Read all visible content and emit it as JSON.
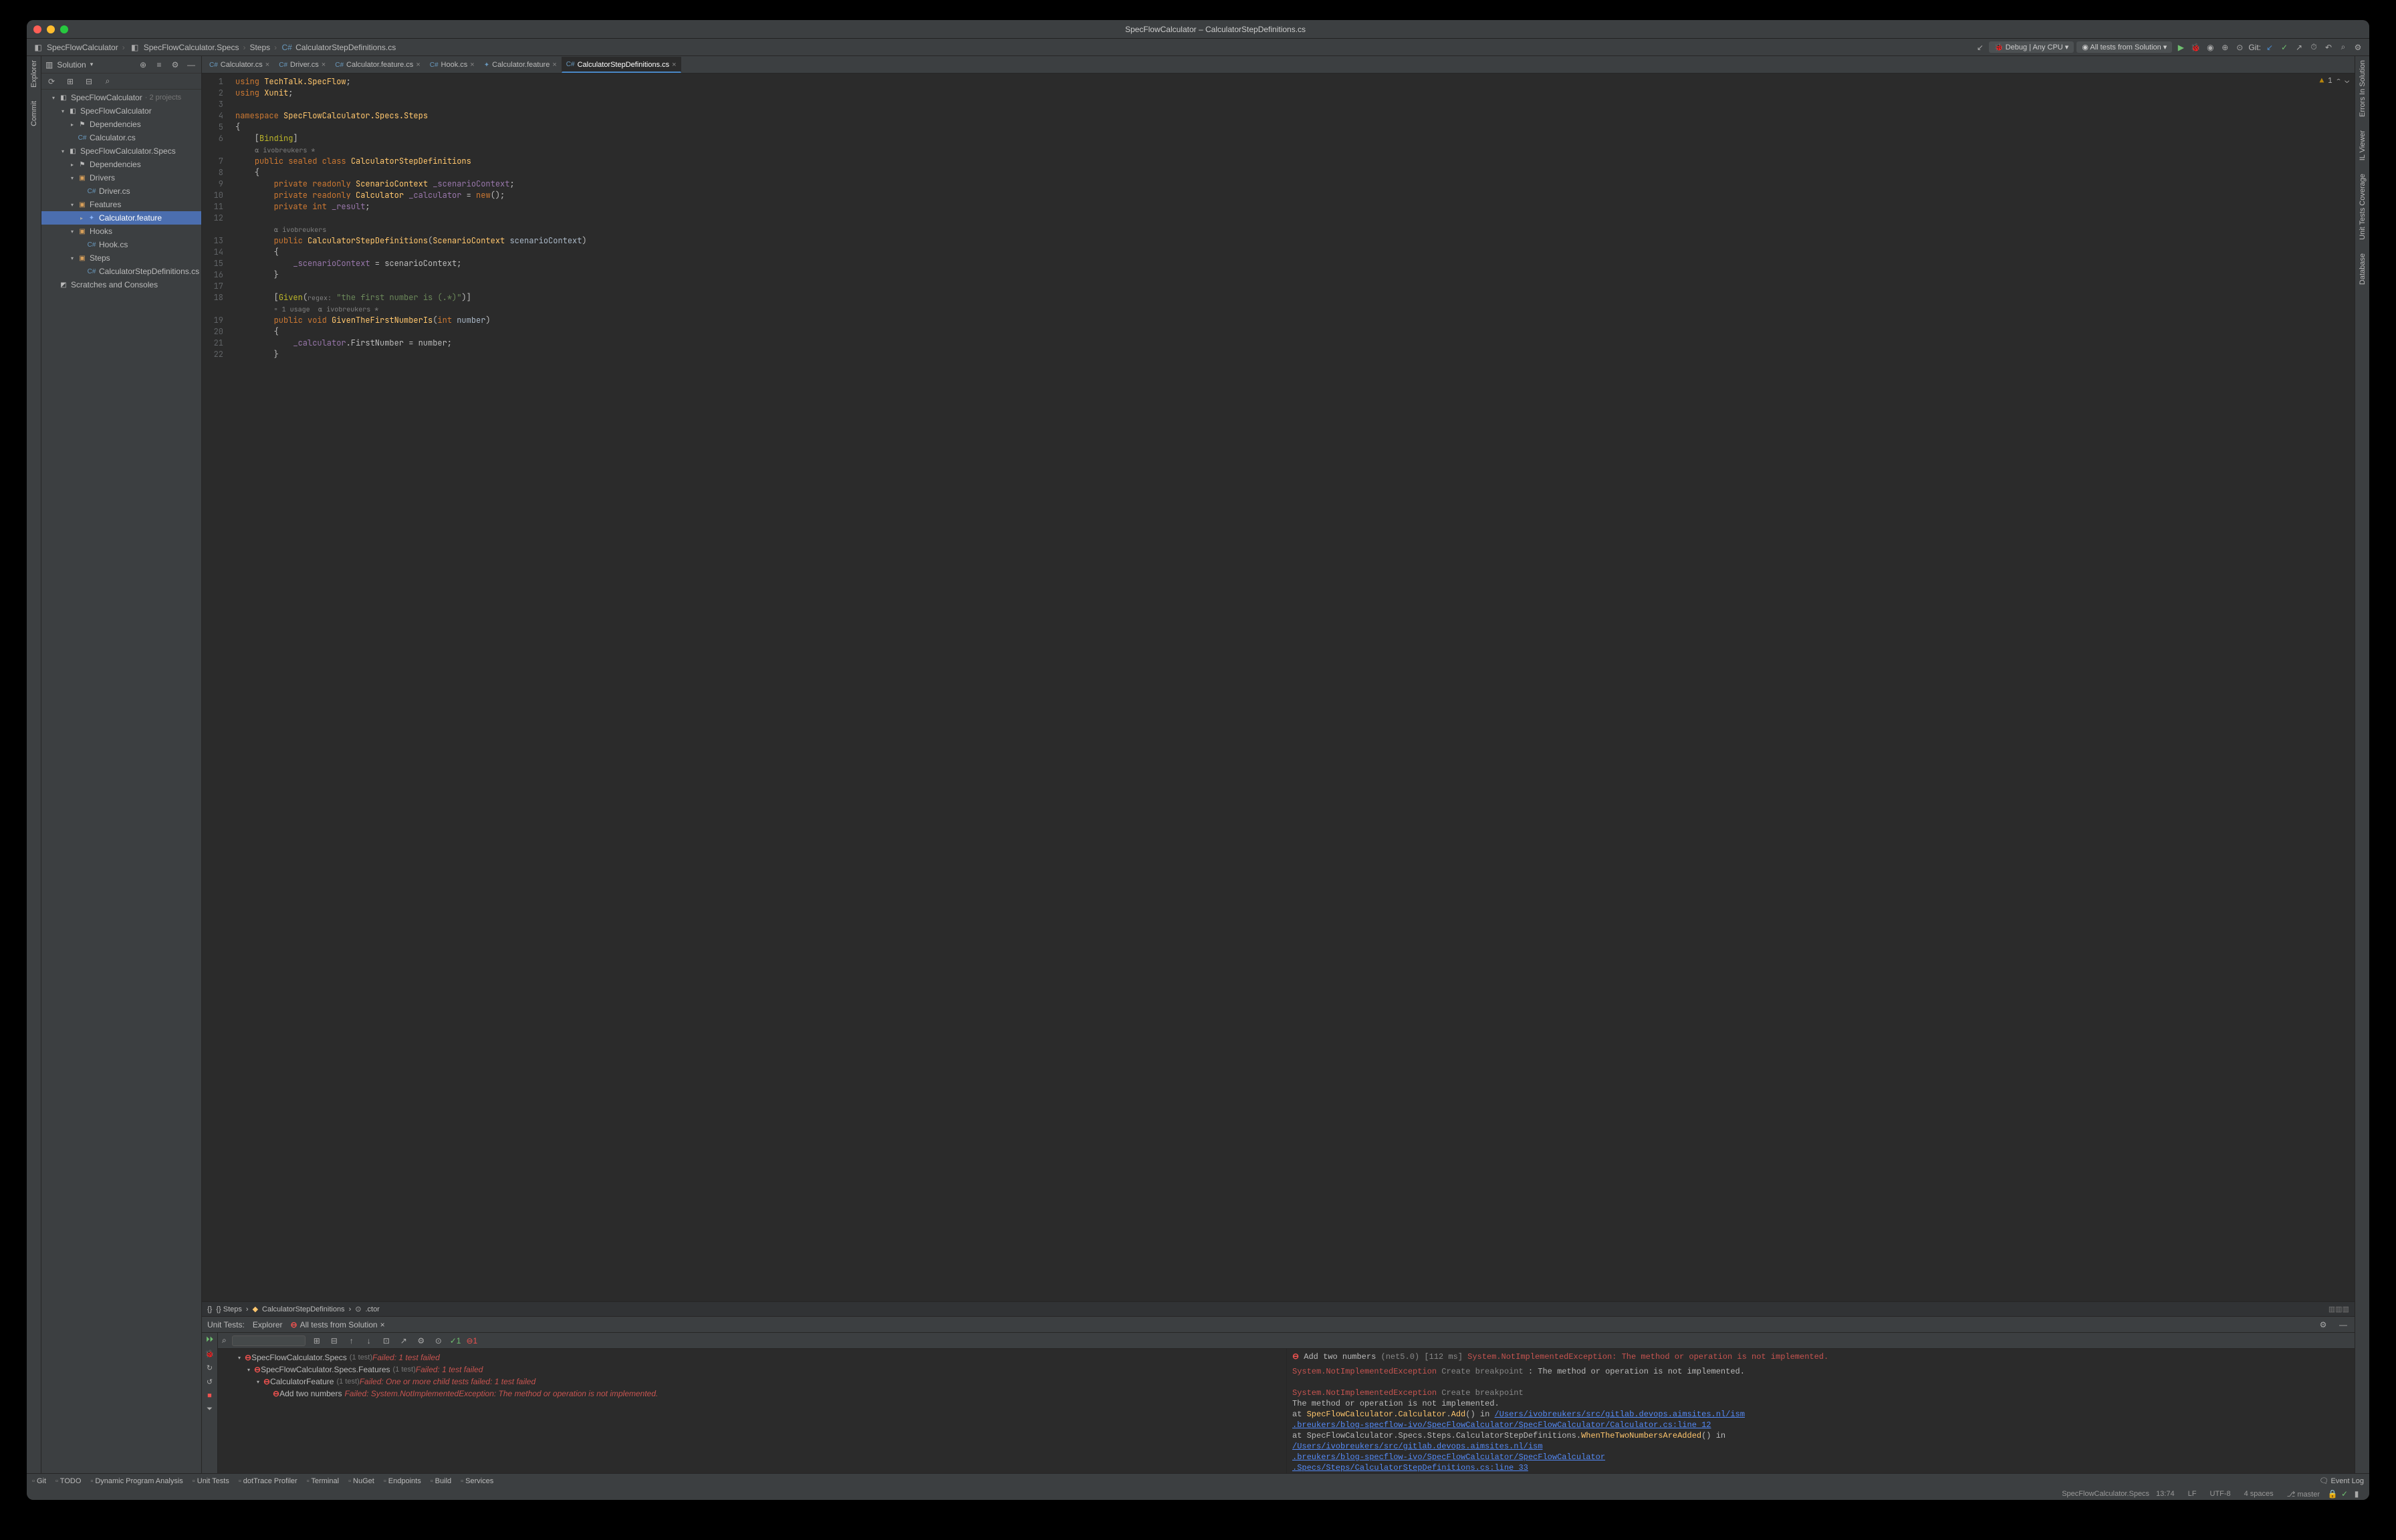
{
  "window_title": "SpecFlowCalculator – CalculatorStepDefinitions.cs",
  "breadcrumbs": [
    "SpecFlowCalculator",
    "SpecFlowCalculator.Specs",
    "Steps",
    "CalculatorStepDefinitions.cs"
  ],
  "run_config": "Debug | Any CPU",
  "run_target": "All tests from Solution",
  "vcs_label": "Git:",
  "left_gutter": [
    "Explorer",
    "Commit"
  ],
  "right_gutter": [
    "Errors In Solution",
    "IL Viewer",
    "Unit Tests Coverage",
    "Database"
  ],
  "explorer": {
    "title": "Solution",
    "tree": [
      {
        "pad": 16,
        "arrow": "▾",
        "icon": "◧",
        "ic": "",
        "label": "SpecFlowCalculator",
        "sub": " · 2 projects"
      },
      {
        "pad": 30,
        "arrow": "▾",
        "icon": "◧",
        "ic": "",
        "label": "SpecFlowCalculator"
      },
      {
        "pad": 44,
        "arrow": "▸",
        "icon": "⚑",
        "ic": "",
        "label": "Dependencies"
      },
      {
        "pad": 44,
        "arrow": "",
        "icon": "C#",
        "ic": "fi-cs",
        "label": "Calculator.cs"
      },
      {
        "pad": 30,
        "arrow": "▾",
        "icon": "◧",
        "ic": "",
        "label": "SpecFlowCalculator.Specs"
      },
      {
        "pad": 44,
        "arrow": "▸",
        "icon": "⚑",
        "ic": "",
        "label": "Dependencies"
      },
      {
        "pad": 44,
        "arrow": "▾",
        "icon": "▣",
        "ic": "fi-folder",
        "label": "Drivers"
      },
      {
        "pad": 58,
        "arrow": "",
        "icon": "C#",
        "ic": "fi-cs",
        "label": "Driver.cs"
      },
      {
        "pad": 44,
        "arrow": "▾",
        "icon": "▣",
        "ic": "fi-folder",
        "label": "Features"
      },
      {
        "pad": 58,
        "arrow": "▸",
        "icon": "✦",
        "ic": "fi-feature",
        "label": "Calculator.feature",
        "sel": true
      },
      {
        "pad": 44,
        "arrow": "▾",
        "icon": "▣",
        "ic": "fi-folder",
        "label": "Hooks"
      },
      {
        "pad": 58,
        "arrow": "",
        "icon": "C#",
        "ic": "fi-cs",
        "label": "Hook.cs"
      },
      {
        "pad": 44,
        "arrow": "▾",
        "icon": "▣",
        "ic": "fi-folder",
        "label": "Steps"
      },
      {
        "pad": 58,
        "arrow": "",
        "icon": "C#",
        "ic": "fi-cs",
        "label": "CalculatorStepDefinitions.cs"
      },
      {
        "pad": 16,
        "arrow": "",
        "icon": "◩",
        "ic": "",
        "label": "Scratches and Consoles"
      }
    ]
  },
  "tabs": [
    {
      "icon": "C#",
      "label": "Calculator.cs"
    },
    {
      "icon": "C#",
      "label": "Driver.cs"
    },
    {
      "icon": "C#",
      "label": "Calculator.feature.cs"
    },
    {
      "icon": "C#",
      "label": "Hook.cs"
    },
    {
      "icon": "✦",
      "label": "Calculator.feature"
    },
    {
      "icon": "C#",
      "label": "CalculatorStepDefinitions.cs",
      "active": true
    }
  ],
  "inspections": {
    "warn_count": "1"
  },
  "code_lines": [
    {
      "n": 1,
      "html": "<span class='kw'>using</span> <span class='cls'>TechTalk.SpecFlow</span>;"
    },
    {
      "n": 2,
      "html": "<span class='kw'>using</span> <span class='cls'>Xunit</span>;"
    },
    {
      "n": 3,
      "html": ""
    },
    {
      "n": 4,
      "html": "<span class='kw'>namespace</span> <span class='cls'>SpecFlowCalculator.Specs.Steps</span>"
    },
    {
      "n": 5,
      "html": "{"
    },
    {
      "n": 6,
      "html": "    [<span class='attr'>Binding</span>]"
    },
    {
      "n": 0,
      "html": "    <span class='comment'>⍺ ivobreukers *</span>"
    },
    {
      "n": 7,
      "html": "    <span class='kw'>public sealed class</span> <span class='cls'>CalculatorStepDefinitions</span>"
    },
    {
      "n": 8,
      "html": "    {"
    },
    {
      "n": 9,
      "html": "        <span class='kw'>private readonly</span> <span class='cls'>ScenarioContext</span> <span class='ident'>_scenarioContext</span>;"
    },
    {
      "n": 10,
      "html": "        <span class='kw'>private readonly</span> <span class='cls'>Calculator</span> <span class='ident'>_calculator</span> = <span class='kw'>new</span>();"
    },
    {
      "n": 11,
      "html": "        <span class='kw'>private int</span> <span class='ident'>_result</span>;"
    },
    {
      "n": 12,
      "html": ""
    },
    {
      "n": 0,
      "html": "        <span class='comment'>⍺ ivobreukers</span>"
    },
    {
      "n": 13,
      "html": "        <span class='kw'>public</span> <span class='cls'>CalculatorStepDefinitions</span>(<span class='cls'>ScenarioContext</span> <span class='param'>scenarioContext</span>)"
    },
    {
      "n": 14,
      "html": "        {"
    },
    {
      "n": 15,
      "html": "            <span class='ident'>_scenarioContext</span> = scenarioContext;"
    },
    {
      "n": 16,
      "html": "        }"
    },
    {
      "n": 17,
      "html": ""
    },
    {
      "n": 18,
      "html": "        [<span class='attr'>Given</span>(<span class='comment'>regex:</span> <span class='str'>\"the first number is (.*)\"</span>)]"
    },
    {
      "n": 0,
      "html": "        <span class='comment'>▫ 1 usage  ⍺ ivobreukers *</span>"
    },
    {
      "n": 19,
      "html": "        <span class='kw'>public void</span> <span class='cls'>GivenTheFirstNumberIs</span>(<span class='kw'>int</span> <span class='param'>number</span>)"
    },
    {
      "n": 20,
      "html": "        {"
    },
    {
      "n": 21,
      "html": "            <span class='ident'>_calculator</span>.FirstNumber = number;"
    },
    {
      "n": 22,
      "html": "        }"
    }
  ],
  "editor_crumb": [
    "{} Steps",
    "CalculatorStepDefinitions",
    ".ctor"
  ],
  "unit_tests": {
    "title": "Unit Tests:",
    "explorer_label": "Explorer",
    "session": "All tests from Solution",
    "filter_placeholder": "",
    "counts": {
      "pass": "1",
      "fail": "1"
    },
    "tree": [
      {
        "pad": 30,
        "arrow": "▾",
        "label": "SpecFlowCalculator.Specs",
        "sub": "(1 test)",
        "msg": "Failed: 1 test failed"
      },
      {
        "pad": 44,
        "arrow": "▾",
        "label": "SpecFlowCalculator.Specs.Features",
        "sub": "(1 test)",
        "msg": "Failed: 1 test failed"
      },
      {
        "pad": 58,
        "arrow": "▾",
        "label": "CalculatorFeature",
        "sub": "(1 test)",
        "msg": "Failed: One or more child tests failed: 1 test failed"
      },
      {
        "pad": 72,
        "arrow": "",
        "label": "Add two numbers",
        "sub": "",
        "msg": "Failed: System.NotImplementedException: The method or operation is not implemented."
      }
    ],
    "output_header": {
      "name": "Add two numbers",
      "target": "(net5.0)",
      "time": "[112 ms]",
      "ex": "System.NotImplementedException: The method or operation is not implemented."
    },
    "output_lines": [
      "<span class='ex'>System.NotImplementedException</span> <span class='gray'>Create breakpoint</span> : The method or operation is not implemented.",
      "",
      "<span class='ex'>System.NotImplementedException</span> <span class='gray'>Create breakpoint</span>",
      "The method or operation is not implemented.",
      "   at <span class='method'>SpecFlowCalculator.Calculator</span>.<span class='method'>Add</span>() in <span class='link'>/Users/ivobreukers/src/gitlab.devops.aimsites.nl/ism</span>",
      "<span class='link'>.breukers/blog-specflow-ivo/SpecFlowCalculator/SpecFlowCalculator/Calculator.cs:line 12</span>",
      "   at SpecFlowCalculator.Specs.Steps.CalculatorStepDefinitions.<span class='method'>WhenTheTwoNumbersAreAdded</span>() in",
      "<span class='link'>/Users/ivobreukers/src/gitlab.devops.aimsites.nl/ism</span>",
      "<span class='link'>.breukers/blog-specflow-ivo/SpecFlowCalculator/SpecFlowCalculator</span>",
      "<span class='link'>.Specs/Steps/CalculatorStepDefinitions.cs:line 33</span>"
    ]
  },
  "bottom_tools": [
    "Git",
    "TODO",
    "Dynamic Program Analysis",
    "Unit Tests",
    "dotTrace Profiler",
    "Terminal",
    "NuGet",
    "Endpoints",
    "Build",
    "Services"
  ],
  "event_log": "Event Log",
  "status": {
    "context": "SpecFlowCalculator.Specs",
    "pos": "13:74",
    "eol": "LF",
    "enc": "UTF-8",
    "indent": "4 spaces",
    "branch": "master"
  }
}
